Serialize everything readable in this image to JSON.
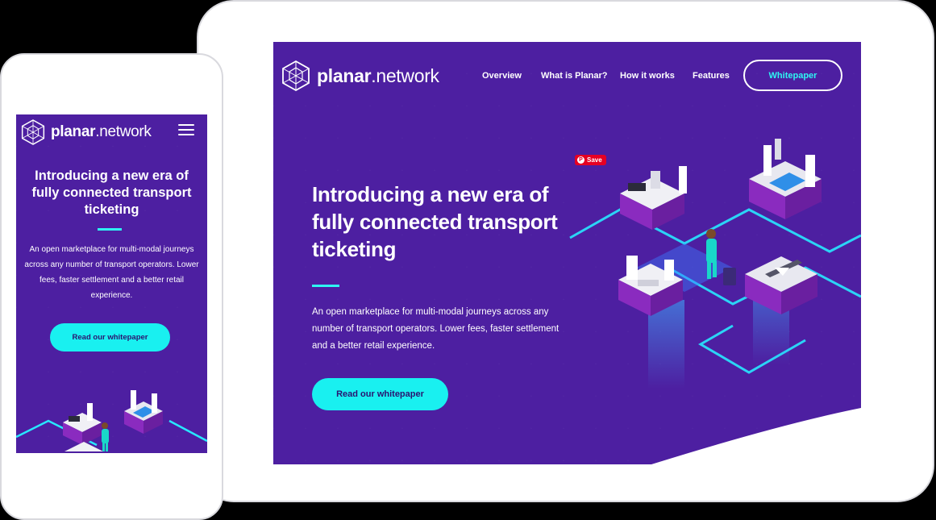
{
  "brand": {
    "name_bold": "planar",
    "name_light": ".network"
  },
  "nav": {
    "overview": "Overview",
    "what_is": "What is Planar?",
    "how_it_works": "How it works",
    "features": "Features",
    "whitepaper": "Whitepaper"
  },
  "hero": {
    "title": "Introducing a new era of fully connected transport ticketing",
    "description": "An open marketplace for multi-modal journeys across any number of transport operators. Lower fees, faster settlement and a better retail experience.",
    "cta": "Read our whitepaper"
  },
  "pin_save": "Save",
  "colors": {
    "background": "#4d1fa1",
    "accent_cyan": "#19f0f0",
    "button_text": "#2a1570",
    "pinterest_red": "#e60023"
  },
  "icons": [
    "planar-hexagon-logo-icon",
    "hamburger-menu-icon",
    "pinterest-icon",
    "isometric-city-illustration"
  ]
}
